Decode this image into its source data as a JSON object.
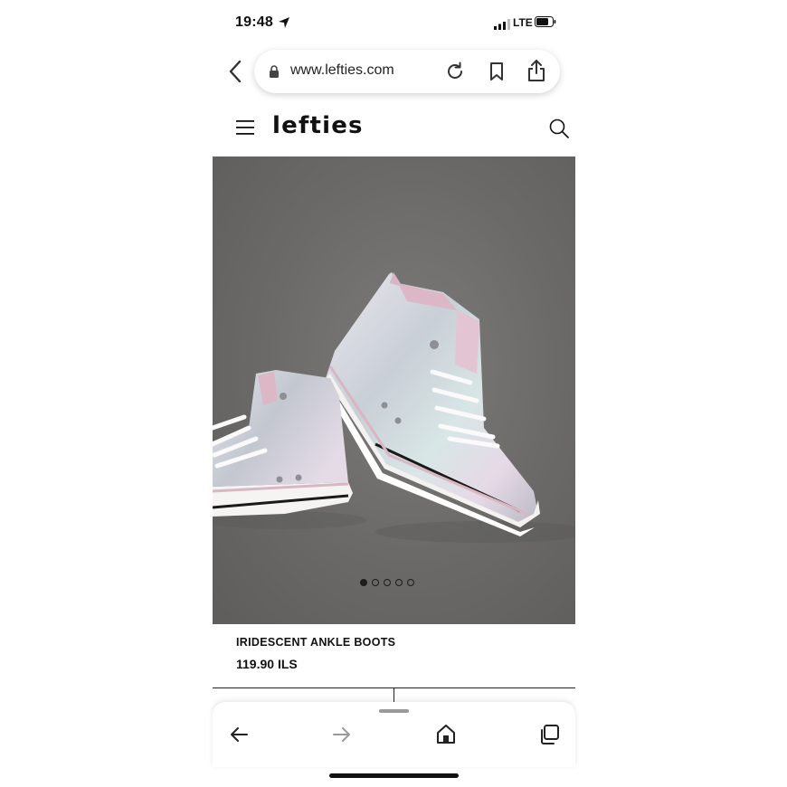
{
  "status_bar": {
    "time": "19:48",
    "network": "LTE",
    "icons": [
      "location-arrow-icon",
      "signal-bars-icon",
      "battery-icon"
    ]
  },
  "browser": {
    "url": "www.lefties.com",
    "icons": [
      "back-chevron-icon",
      "lock-icon",
      "reload-icon",
      "bookmark-icon",
      "share-icon"
    ]
  },
  "site_header": {
    "logo": "lefties",
    "icons": [
      "hamburger-menu-icon",
      "search-icon"
    ]
  },
  "product": {
    "name": "IRIDESCENT ANKLE BOOTS",
    "price": "119.90 ILS",
    "image_alt": "iridescent-high-top-sneakers",
    "carousel": {
      "total": 5,
      "active": 1
    }
  },
  "toolbar": {
    "icons": [
      "back-arrow-icon",
      "forward-arrow-icon",
      "home-icon",
      "tabs-icon"
    ]
  },
  "colors": {
    "background": "#ffffff",
    "image_bg": "#6a6967",
    "text": "#111111",
    "forward_disabled": "#9a9a9a"
  }
}
